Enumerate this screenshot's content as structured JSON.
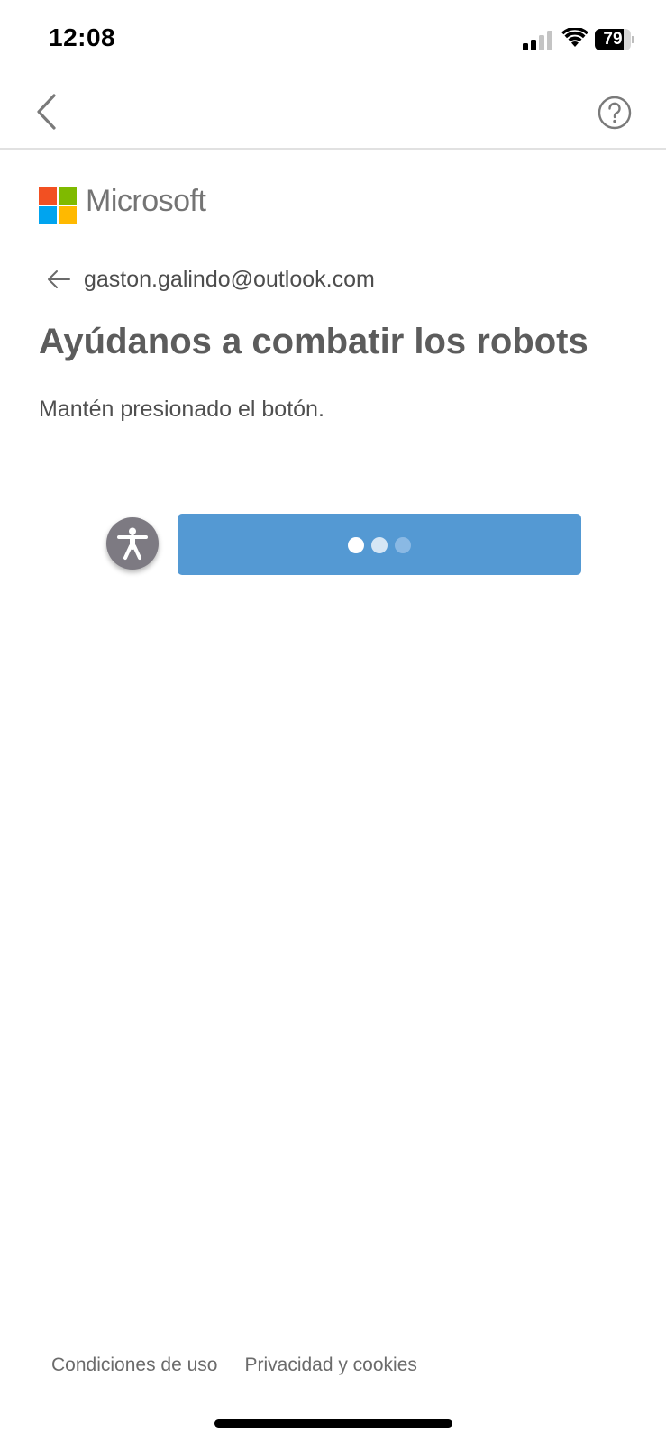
{
  "status_bar": {
    "time": "12:08",
    "battery_percent": "79",
    "battery_level": 0.79
  },
  "nav": {
    "back_icon": "chevron-left-icon",
    "help_icon": "question-circle-icon"
  },
  "brand": {
    "name": "Microsoft",
    "logo_colors": [
      "#f25022",
      "#7fba00",
      "#00a4ef",
      "#ffb900"
    ]
  },
  "identity": {
    "email": "gaston.galindo@outlook.com",
    "icon": "arrow-left-icon"
  },
  "challenge": {
    "title": "Ayúdanos a combatir los robots",
    "instruction": "Mantén presionado el botón.",
    "accessibility_icon": "accessibility-icon",
    "button_state": "loading",
    "button_color": "#5499d3"
  },
  "footer": {
    "terms": "Condiciones de uso",
    "privacy": "Privacidad y cookies"
  }
}
